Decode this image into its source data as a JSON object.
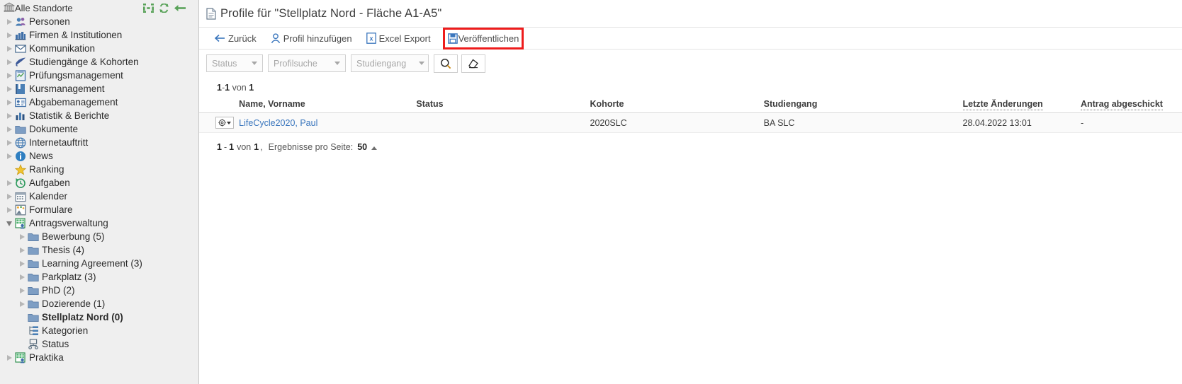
{
  "sidebar": {
    "header": {
      "label": "Alle Standorte",
      "icon": "bank-icon",
      "actions": [
        {
          "name": "collapse-all-icon",
          "title": "collapse-all"
        },
        {
          "name": "refresh-icon",
          "title": "refresh"
        },
        {
          "name": "back-arrow-icon",
          "title": "back"
        }
      ]
    },
    "items": [
      {
        "label": "Personen",
        "icon": "people-icon",
        "level": 1,
        "expandable": true,
        "expanded": false,
        "bold": false
      },
      {
        "label": "Firmen & Institutionen",
        "icon": "factory-icon",
        "level": 1,
        "expandable": true,
        "expanded": false,
        "bold": false
      },
      {
        "label": "Kommunikation",
        "icon": "envelope-icon",
        "level": 1,
        "expandable": true,
        "expanded": false,
        "bold": false
      },
      {
        "label": "Studiengänge & Kohorten",
        "icon": "graduation-icon",
        "level": 1,
        "expandable": true,
        "expanded": false,
        "bold": false
      },
      {
        "label": "Prüfungsmanagement",
        "icon": "exam-icon",
        "level": 1,
        "expandable": true,
        "expanded": false,
        "bold": false
      },
      {
        "label": "Kursmanagement",
        "icon": "book-icon",
        "level": 1,
        "expandable": true,
        "expanded": false,
        "bold": false
      },
      {
        "label": "Abgabemanagement",
        "icon": "id-card-icon",
        "level": 1,
        "expandable": true,
        "expanded": false,
        "bold": false
      },
      {
        "label": "Statistik & Berichte",
        "icon": "bar-chart-icon",
        "level": 1,
        "expandable": true,
        "expanded": false,
        "bold": false
      },
      {
        "label": "Dokumente",
        "icon": "folder-icon",
        "level": 1,
        "expandable": true,
        "expanded": false,
        "bold": false
      },
      {
        "label": "Internetauftritt",
        "icon": "globe-icon",
        "level": 1,
        "expandable": true,
        "expanded": false,
        "bold": false
      },
      {
        "label": "News",
        "icon": "info-icon",
        "level": 1,
        "expandable": true,
        "expanded": false,
        "bold": false
      },
      {
        "label": "Ranking",
        "icon": "star-icon",
        "level": 1,
        "expandable": false,
        "expanded": false,
        "bold": false
      },
      {
        "label": "Aufgaben",
        "icon": "clock-history-icon",
        "level": 1,
        "expandable": true,
        "expanded": false,
        "bold": false
      },
      {
        "label": "Kalender",
        "icon": "calendar-icon",
        "level": 1,
        "expandable": true,
        "expanded": false,
        "bold": false
      },
      {
        "label": "Formulare",
        "icon": "form-icon",
        "level": 1,
        "expandable": true,
        "expanded": false,
        "bold": false
      },
      {
        "label": "Antragsverwaltung",
        "icon": "application-admin-icon",
        "level": 1,
        "expandable": true,
        "expanded": true,
        "bold": false
      },
      {
        "label": "Bewerbung (5)",
        "icon": "folder-icon",
        "level": 2,
        "expandable": true,
        "expanded": false,
        "bold": false
      },
      {
        "label": "Thesis (4)",
        "icon": "folder-icon",
        "level": 2,
        "expandable": true,
        "expanded": false,
        "bold": false
      },
      {
        "label": "Learning Agreement (3)",
        "icon": "folder-icon",
        "level": 2,
        "expandable": true,
        "expanded": false,
        "bold": false
      },
      {
        "label": "Parkplatz (3)",
        "icon": "folder-icon",
        "level": 2,
        "expandable": true,
        "expanded": false,
        "bold": false
      },
      {
        "label": "PhD (2)",
        "icon": "folder-icon",
        "level": 2,
        "expandable": true,
        "expanded": false,
        "bold": false
      },
      {
        "label": "Dozierende (1)",
        "icon": "folder-icon",
        "level": 2,
        "expandable": true,
        "expanded": false,
        "bold": false
      },
      {
        "label": "Stellplatz Nord (0)",
        "icon": "folder-icon",
        "level": 2,
        "expandable": false,
        "expanded": false,
        "bold": true
      },
      {
        "label": "Kategorien",
        "icon": "categories-icon",
        "level": 2,
        "expandable": false,
        "expanded": false,
        "bold": false
      },
      {
        "label": "Status",
        "icon": "status-network-icon",
        "level": 2,
        "expandable": false,
        "expanded": false,
        "bold": false
      },
      {
        "label": "Praktika",
        "icon": "application-admin-icon",
        "level": 1,
        "expandable": true,
        "expanded": false,
        "bold": false
      }
    ]
  },
  "main": {
    "page_title": "Profile für \"Stellplatz Nord - Fläche A1-A5\"",
    "page_title_icon": "document-icon",
    "toolbar": [
      {
        "label": "Zurück",
        "icon": "arrow-left-icon",
        "highlighted": false
      },
      {
        "label": "Profil hinzufügen",
        "icon": "person-add-icon",
        "highlighted": false
      },
      {
        "label": "Excel Export",
        "icon": "excel-icon",
        "highlighted": false
      },
      {
        "label": "Veröffentlichen",
        "icon": "save-publish-icon",
        "highlighted": true
      }
    ],
    "filters": [
      {
        "label": "Status",
        "name": "status-filter"
      },
      {
        "label": "Profilsuche",
        "name": "profilsuche-filter"
      },
      {
        "label": "Studiengang",
        "name": "studiengang-filter"
      }
    ],
    "filter_buttons": [
      {
        "name": "search-icon",
        "label": "search"
      },
      {
        "name": "eraser-icon",
        "label": "clear"
      }
    ],
    "result_count": {
      "from": "1",
      "dash": "-",
      "to": "1",
      "von": "von",
      "total": "1"
    },
    "table": {
      "columns": [
        {
          "label": "",
          "key": "gear",
          "sortable": false
        },
        {
          "label": "Name, Vorname",
          "key": "name",
          "sortable": false
        },
        {
          "label": "Status",
          "key": "status",
          "sortable": false
        },
        {
          "label": "Kohorte",
          "key": "kohorte",
          "sortable": false
        },
        {
          "label": "Studiengang",
          "key": "studiengang",
          "sortable": false
        },
        {
          "label": "Letzte Änderungen",
          "key": "letzte_aenderungen",
          "sortable": true
        },
        {
          "label": "Antrag abgeschickt",
          "key": "antrag_abgeschickt",
          "sortable": true
        }
      ],
      "rows": [
        {
          "name": "LifeCycle2020, Paul",
          "status": "",
          "kohorte": "2020SLC",
          "studiengang": "BA SLC",
          "letzte_aenderungen": "28.04.2022 13:01",
          "antrag_abgeschickt": "-"
        }
      ]
    },
    "pager": {
      "from": "1",
      "dash": "-",
      "to": "1",
      "von": "von",
      "total": "1",
      "comma": ",",
      "per_page_label": "Ergebnisse pro Seite:",
      "per_page_value": "50"
    }
  },
  "colors": {
    "sidebar_bg": "#efefef",
    "highlight_red": "#ee1c1c",
    "link_blue": "#3a76bd",
    "accent_green": "#5aa35a"
  }
}
